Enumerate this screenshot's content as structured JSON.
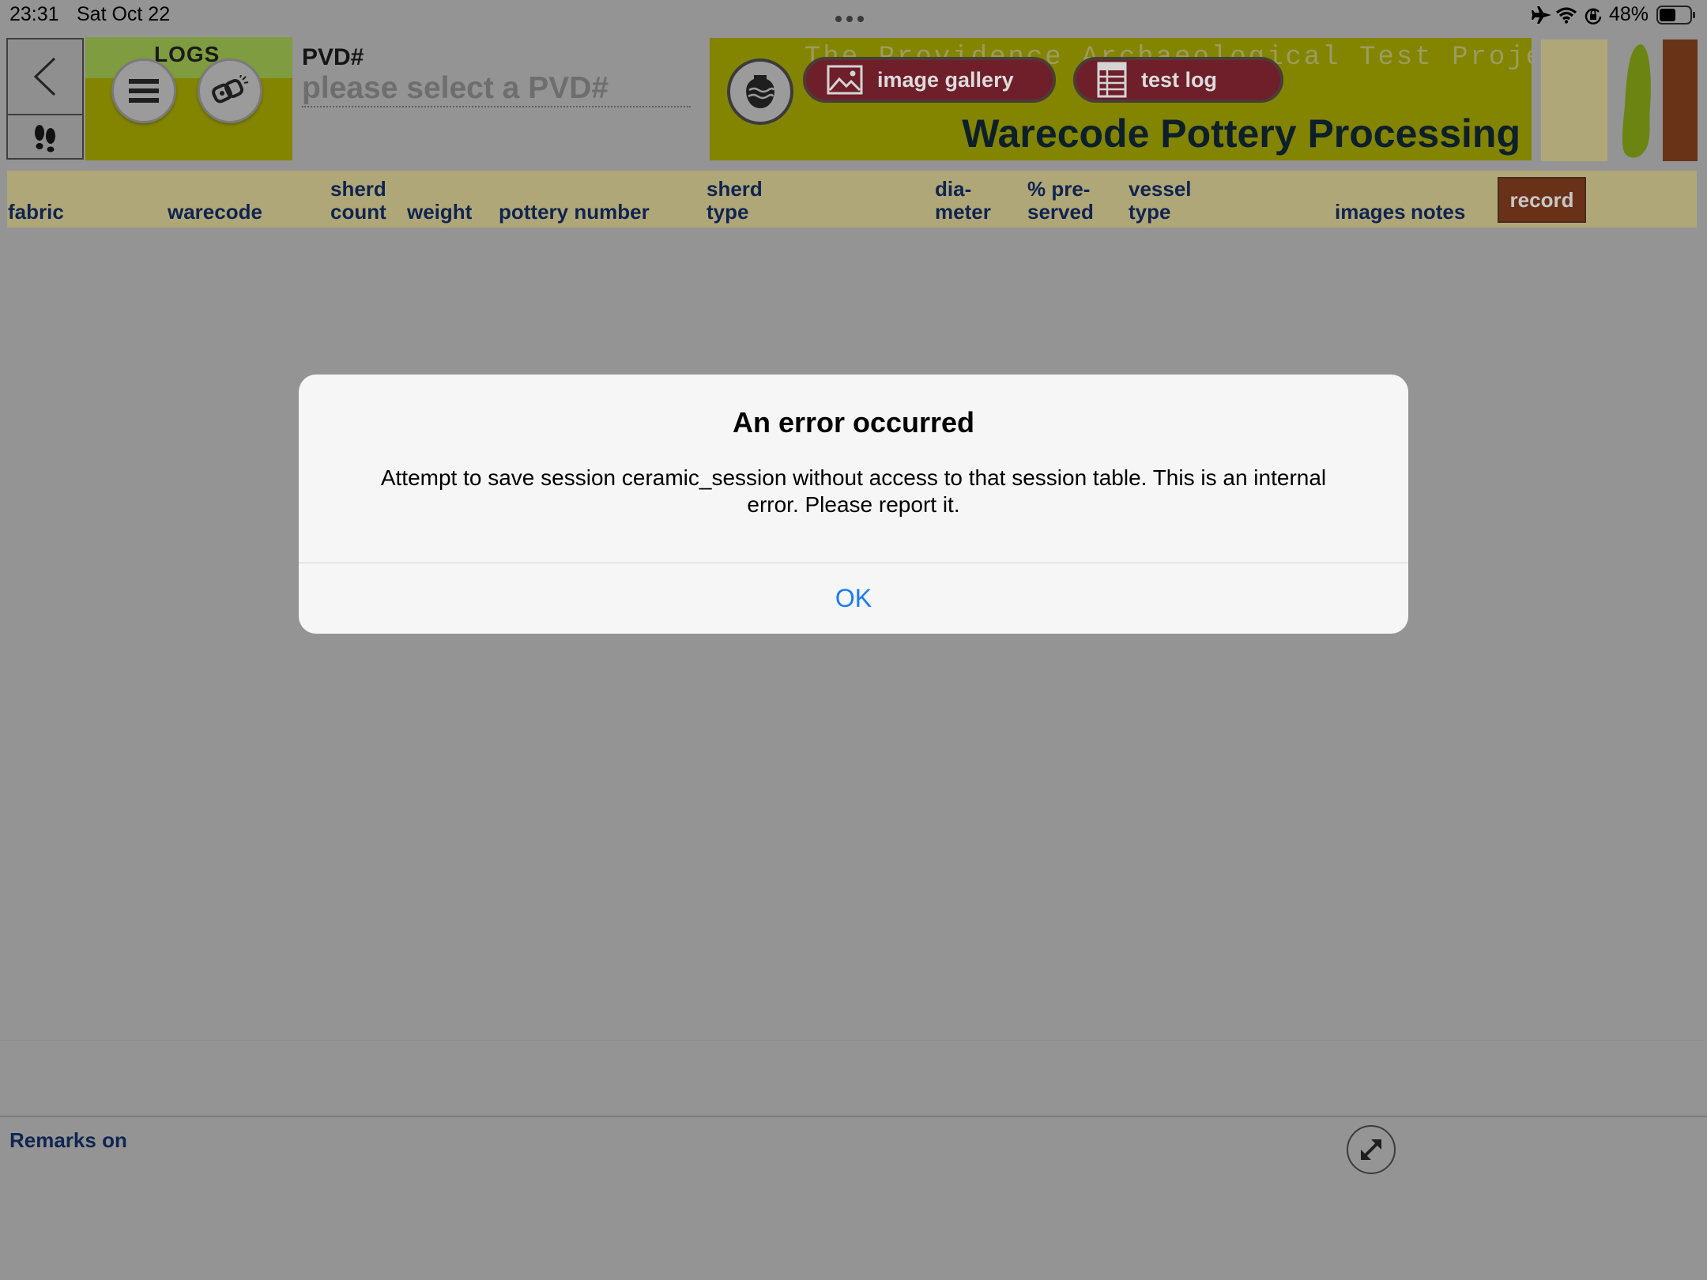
{
  "status_bar": {
    "time": "23:31",
    "date": "Sat Oct 22",
    "battery": "48%"
  },
  "logs_panel": {
    "label": "LOGS"
  },
  "pvd": {
    "label": "PVD#",
    "placeholder": "please select a PVD#"
  },
  "banner": {
    "project_title": "The Providence Archaeological Test Project",
    "title": "Warecode Pottery Processing",
    "image_gallery_label": "image gallery",
    "test_log_label": "test log"
  },
  "columns": {
    "fabric": "fabric",
    "warecode": "warecode",
    "sherd_count_1": "sherd",
    "sherd_count_2": "count",
    "weight": "weight",
    "pottery_number": "pottery number",
    "sherd_type_1": "sherd",
    "sherd_type_2": "type",
    "diameter_1": "dia-",
    "diameter_2": "meter",
    "preserved_1": "% pre-",
    "preserved_2": "served",
    "vessel_type_1": "vessel",
    "vessel_type_2": "type",
    "images": "images",
    "notes": "notes",
    "record": "record"
  },
  "footer": {
    "remarks_label": "Remarks on"
  },
  "dialog": {
    "title": "An error occurred",
    "message": "Attempt to save session ceramic_session without access to that session table. This is an internal error. Please report it.",
    "ok_label": "OK"
  },
  "colors": {
    "banner_olive": "#838400",
    "header_tan": "#b0a778",
    "pill_maroon": "#6e1f2a",
    "record_brown": "#6a3119",
    "ios_blue": "#1a7df2"
  }
}
